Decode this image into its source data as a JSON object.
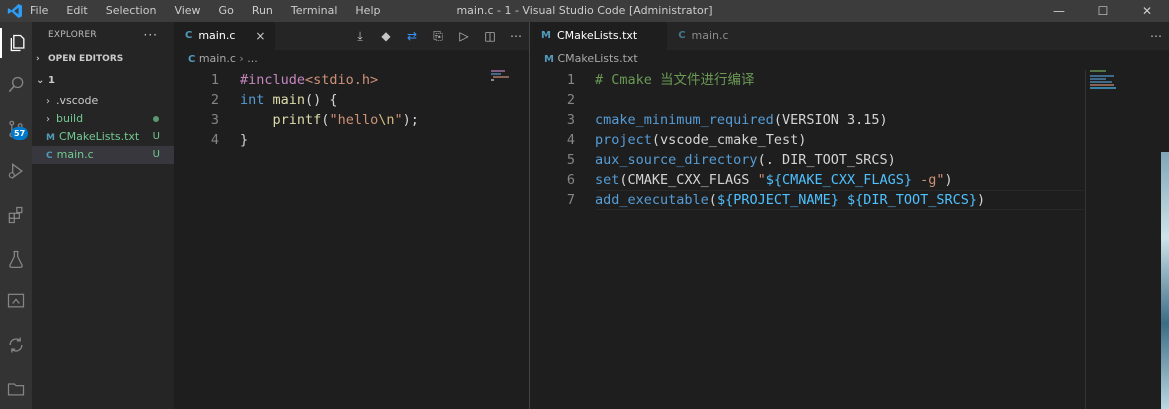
{
  "window": {
    "title": "main.c - 1 - Visual Studio Code [Administrator]",
    "menu": [
      "File",
      "Edit",
      "Selection",
      "View",
      "Go",
      "Run",
      "Terminal",
      "Help"
    ],
    "logo_icon": "vscode-icon",
    "controls": [
      "minimize-icon",
      "maximize-icon",
      "close-icon"
    ]
  },
  "activity_bar": {
    "items": [
      "explorer-icon",
      "search-icon",
      "source-control-icon",
      "run-debug-icon",
      "extensions-icon",
      "testing-icon",
      "remote-explorer-icon",
      "sync-icon",
      "folder-icon"
    ],
    "scm_badge": "57"
  },
  "explorer": {
    "title": "EXPLORER",
    "more": "···",
    "open_editors": "OPEN EDITORS",
    "folder": "1",
    "items": [
      {
        "name": ".vscode",
        "type": "folder",
        "status": "",
        "color": "#cccccc"
      },
      {
        "name": "build",
        "type": "folder",
        "status": "",
        "color": "#73c991"
      },
      {
        "name": "CMakeLists.txt",
        "type": "file",
        "icon": "M",
        "icon_color": "#519aba",
        "status": "U",
        "color": "#73c991"
      },
      {
        "name": "main.c",
        "type": "file",
        "icon": "C",
        "icon_color": "#519aba",
        "status": "U",
        "color": "#73c991"
      }
    ]
  },
  "editor_left": {
    "tab": {
      "icon": "C",
      "label": "main.c",
      "close": "×"
    },
    "toolbar": [
      "download-icon",
      "git-diamond-icon",
      "compare-icon",
      "copy-icon",
      "run-icon",
      "split-editor-icon",
      "more-icon"
    ],
    "breadcrumb": [
      "main.c",
      "..."
    ],
    "lines": [
      {
        "num": "1",
        "tokens": [
          {
            "t": "#include",
            "c": "#c586c0"
          },
          {
            "t": "<stdio.h>",
            "c": "#ce9178"
          }
        ]
      },
      {
        "num": "2",
        "tokens": [
          {
            "t": "int",
            "c": "#569cd6"
          },
          {
            "t": " ",
            "c": "#d4d4d4"
          },
          {
            "t": "main",
            "c": "#dcdcaa"
          },
          {
            "t": "() {",
            "c": "#d4d4d4"
          }
        ]
      },
      {
        "num": "3",
        "tokens": [
          {
            "t": "    ",
            "c": "#d4d4d4"
          },
          {
            "t": "printf",
            "c": "#dcdcaa"
          },
          {
            "t": "(",
            "c": "#d4d4d4"
          },
          {
            "t": "\"hello",
            "c": "#ce9178"
          },
          {
            "t": "\\n",
            "c": "#d7ba7d"
          },
          {
            "t": "\"",
            "c": "#ce9178"
          },
          {
            "t": ");",
            "c": "#d4d4d4"
          }
        ]
      },
      {
        "num": "4",
        "tokens": [
          {
            "t": "}",
            "c": "#d4d4d4"
          }
        ]
      }
    ]
  },
  "editor_right": {
    "tabs": [
      {
        "icon": "M",
        "label": "CMakeLists.txt",
        "active": true
      },
      {
        "icon": "C",
        "label": "main.c",
        "active": false
      }
    ],
    "toolbar": [
      "more-icon"
    ],
    "breadcrumb": [
      "CMakeLists.txt"
    ],
    "lines": [
      {
        "num": "1",
        "tokens": [
          {
            "t": "# Cmake 当文件进行编译",
            "c": "#6a9955"
          }
        ]
      },
      {
        "num": "2",
        "tokens": []
      },
      {
        "num": "3",
        "tokens": [
          {
            "t": "cmake_minimum_required",
            "c": "#569cd6"
          },
          {
            "t": "(VERSION 3.15)",
            "c": "#d4d4d4"
          }
        ]
      },
      {
        "num": "4",
        "tokens": [
          {
            "t": "project",
            "c": "#569cd6"
          },
          {
            "t": "(vscode_cmake_Test)",
            "c": "#d4d4d4"
          }
        ]
      },
      {
        "num": "5",
        "tokens": [
          {
            "t": "aux_source_directory",
            "c": "#569cd6"
          },
          {
            "t": "(. DIR_TOOT_SRCS)",
            "c": "#d4d4d4"
          }
        ]
      },
      {
        "num": "6",
        "tokens": [
          {
            "t": "set",
            "c": "#569cd6"
          },
          {
            "t": "(CMAKE_CXX_FLAGS ",
            "c": "#d4d4d4"
          },
          {
            "t": "\"",
            "c": "#ce9178"
          },
          {
            "t": "${CMAKE_CXX_FLAGS}",
            "c": "#4fc1ff"
          },
          {
            "t": " -g\"",
            "c": "#ce9178"
          },
          {
            "t": ")",
            "c": "#d4d4d4"
          }
        ]
      },
      {
        "num": "7",
        "tokens": [
          {
            "t": "add_executable",
            "c": "#569cd6"
          },
          {
            "t": "(",
            "c": "#d4d4d4"
          },
          {
            "t": "${PROJECT_NAME}",
            "c": "#4fc1ff"
          },
          {
            "t": " ",
            "c": "#d4d4d4"
          },
          {
            "t": "${DIR_TOOT_SRCS}",
            "c": "#4fc1ff"
          },
          {
            "t": ")",
            "c": "#d4d4d4"
          }
        ]
      }
    ]
  }
}
